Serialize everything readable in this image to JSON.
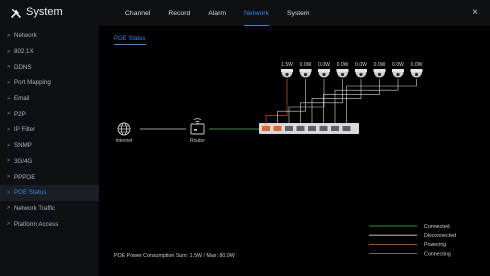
{
  "sidebar": {
    "title": "System",
    "items": [
      {
        "label": "Network",
        "active": false
      },
      {
        "label": "802.1X",
        "active": false
      },
      {
        "label": "DDNS",
        "active": false
      },
      {
        "label": "Port Mapping",
        "active": false
      },
      {
        "label": "Email",
        "active": false
      },
      {
        "label": "P2P",
        "active": false
      },
      {
        "label": "IP Filter",
        "active": false
      },
      {
        "label": "SNMP",
        "active": false
      },
      {
        "label": "3G/4G",
        "active": false
      },
      {
        "label": "PPPOE",
        "active": false
      },
      {
        "label": "POE Status",
        "active": true
      },
      {
        "label": "Network Traffic",
        "active": false
      },
      {
        "label": "Platform Access",
        "active": false
      }
    ]
  },
  "topbar": {
    "tabs": [
      {
        "label": "Channel",
        "active": false
      },
      {
        "label": "Record",
        "active": false
      },
      {
        "label": "Alarm",
        "active": false
      },
      {
        "label": "Network",
        "active": true
      },
      {
        "label": "System",
        "active": false
      }
    ],
    "close_glyph": "×"
  },
  "content": {
    "subtab": "POE Status",
    "internet_label": "Internet",
    "router_label": "Router",
    "cameras": [
      "1.5W",
      "0.0W",
      "0.0W",
      "0.0W",
      "0.0W",
      "0.0W",
      "0.0W",
      "0.0W"
    ],
    "summary": "POE Power Consumption Sum: 1.5W / Max: 80.0W"
  },
  "legend": [
    {
      "label": "Connected",
      "color": "#43c05a"
    },
    {
      "label": "Disconnected",
      "color": "#d8d8d8"
    },
    {
      "label": "Powering",
      "color": "#e2642f"
    },
    {
      "label": "Connecting",
      "color": "#8a8a8a"
    }
  ],
  "colors": {
    "accent": "#3b82e6",
    "connected": "#43c05a",
    "powering": "#e2642f",
    "disconnected": "#d8d8d8"
  }
}
